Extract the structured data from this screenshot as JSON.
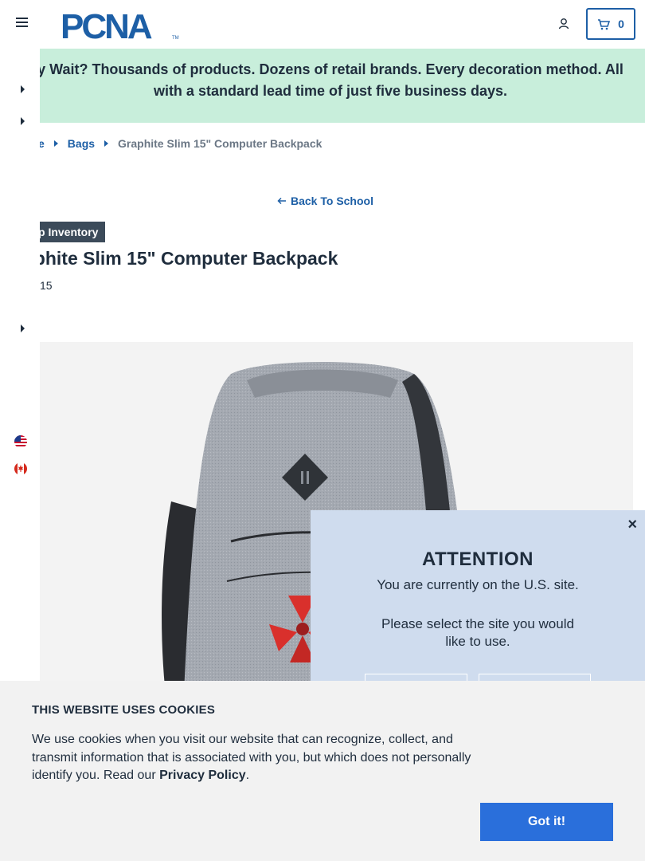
{
  "header": {
    "logo_text": "PCNA",
    "cart_count": "0"
  },
  "banner": {
    "text": "y Wait? Thousands of products. Dozens of retail brands. Every decoration method. All with a standard lead time of just five business days."
  },
  "breadcrumb": {
    "home": "e",
    "bags": "Bags",
    "current": "Graphite Slim 15\" Computer Backpack"
  },
  "back_link": "Back To School",
  "product": {
    "inventory_tag": "p Inventory",
    "title": "aphite Slim 15\" Computer Backpack",
    "sku": "15"
  },
  "modal": {
    "close": "×",
    "title": "ATTENTION",
    "line1": "You are currently on the U.S. site.",
    "line2a": "Please select the site you would",
    "line2b": "like to use."
  },
  "cookie": {
    "title": "THIS WEBSITE USES COOKIES",
    "text_before": "We use cookies when you visit our website that can recognize, collect, and transmit information that is associated with you, but which does not personally identify you. Read our ",
    "policy_link": "Privacy Policy",
    "text_after": ".",
    "button": "Got it!"
  },
  "colors": {
    "brand_blue": "#1d5fa6",
    "banner_green": "#c8eedb",
    "modal_bg": "#cfdcee",
    "cookie_button": "#2a6fdb"
  },
  "icons": [
    "menu-icon",
    "user-icon",
    "cart-icon",
    "us-flag-icon",
    "canada-flag-icon",
    "arrow-left-icon",
    "close-icon"
  ]
}
